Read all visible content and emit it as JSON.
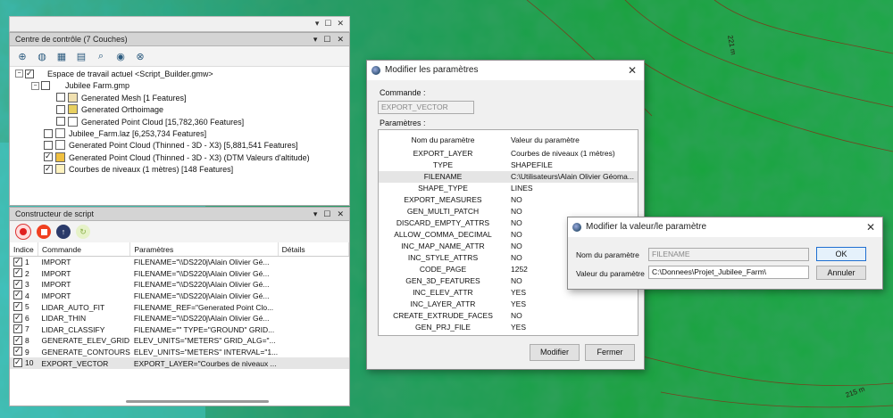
{
  "map": {
    "label_top": "221 m",
    "label_bottom": "215 m"
  },
  "control_center": {
    "title": "Centre de contrôle (7 Couches)",
    "tree": [
      {
        "label": "Espace de travail actuel <Script_Builder.gmw>",
        "checked": true
      },
      {
        "label": "Jubilee Farm.gmp",
        "checked": false
      },
      {
        "label": "Generated Mesh [1 Features]",
        "checked": false
      },
      {
        "label": "Generated Orthoimage",
        "checked": false
      },
      {
        "label": "Generated Point Cloud [15,782,360 Features]",
        "checked": false
      },
      {
        "label": "Jubilee_Farm.laz [6,253,734 Features]",
        "checked": false
      },
      {
        "label": "Generated Point Cloud (Thinned - 3D - X3) [5,881,541 Features]",
        "checked": false
      },
      {
        "label": "Generated Point Cloud (Thinned - 3D - X3) (DTM Valeurs d'altitude)",
        "checked": true
      },
      {
        "label": "Courbes de niveaux (1 mètres) [148 Features]",
        "checked": true
      }
    ]
  },
  "script_builder": {
    "title": "Constructeur de script",
    "columns": [
      "Indice",
      "Commande",
      "Paramètres",
      "Détails"
    ],
    "rows": [
      {
        "index": "1",
        "command": "IMPORT",
        "params": "FILENAME=\"\\\\DS220j\\Alain Olivier Gé..."
      },
      {
        "index": "2",
        "command": "IMPORT",
        "params": "FILENAME=\"\\\\DS220j\\Alain Olivier Gé..."
      },
      {
        "index": "3",
        "command": "IMPORT",
        "params": "FILENAME=\"\\\\DS220j\\Alain Olivier Gé..."
      },
      {
        "index": "4",
        "command": "IMPORT",
        "params": "FILENAME=\"\\\\DS220j\\Alain Olivier Gé..."
      },
      {
        "index": "5",
        "command": "LIDAR_AUTO_FIT",
        "params": "FILENAME_REF=\"Generated Point Clo..."
      },
      {
        "index": "6",
        "command": "LIDAR_THIN",
        "params": "FILENAME=\"\\\\DS220j\\Alain Olivier Gé..."
      },
      {
        "index": "7",
        "command": "LIDAR_CLASSIFY",
        "params": "FILENAME=\"\" TYPE=\"GROUND\" GRID..."
      },
      {
        "index": "8",
        "command": "GENERATE_ELEV_GRID",
        "params": "ELEV_UNITS=\"METERS\" GRID_ALG=\"..."
      },
      {
        "index": "9",
        "command": "GENERATE_CONTOURS",
        "params": "ELEV_UNITS=\"METERS\" INTERVAL=\"1..."
      },
      {
        "index": "10",
        "command": "EXPORT_VECTOR",
        "params": "EXPORT_LAYER=\"Courbes de niveaux ..."
      }
    ]
  },
  "modify_params": {
    "title": "Modifier les paramètres",
    "command_label": "Commande :",
    "command_value": "EXPORT_VECTOR",
    "params_label": "Paramètres :",
    "col_name": "Nom du paramètre",
    "col_value": "Valeur du paramètre",
    "rows": [
      {
        "name": "EXPORT_LAYER",
        "value": "Courbes de niveaux (1 mètres)"
      },
      {
        "name": "TYPE",
        "value": "SHAPEFILE"
      },
      {
        "name": "FILENAME",
        "value": "C:\\Utilisateurs\\Alain Olivier Géoma..."
      },
      {
        "name": "SHAPE_TYPE",
        "value": "LINES"
      },
      {
        "name": "EXPORT_MEASURES",
        "value": "NO"
      },
      {
        "name": "GEN_MULTI_PATCH",
        "value": "NO"
      },
      {
        "name": "DISCARD_EMPTY_ATTRS",
        "value": "NO"
      },
      {
        "name": "ALLOW_COMMA_DECIMAL",
        "value": "NO"
      },
      {
        "name": "INC_MAP_NAME_ATTR",
        "value": "NO"
      },
      {
        "name": "INC_STYLE_ATTRS",
        "value": "NO"
      },
      {
        "name": "CODE_PAGE",
        "value": "1252"
      },
      {
        "name": "GEN_3D_FEATURES",
        "value": "NO"
      },
      {
        "name": "INC_ELEV_ATTR",
        "value": "YES"
      },
      {
        "name": "INC_LAYER_ATTR",
        "value": "YES"
      },
      {
        "name": "CREATE_EXTRUDE_FACES",
        "value": "NO"
      },
      {
        "name": "GEN_PRJ_FILE",
        "value": "YES"
      }
    ],
    "modify_button": "Modifier",
    "close_button": "Fermer"
  },
  "modify_value": {
    "title": "Modifier la valeur/le paramètre",
    "name_label": "Nom du paramètre",
    "name_value": "FILENAME",
    "value_label": "Valeur du paramètre",
    "value_value": "C:\\Donnees\\Projet_Jubilee_Farm\\",
    "ok_button": "OK",
    "cancel_button": "Annuler"
  },
  "colors": {
    "map_green": "#1a8a4c",
    "map_cyan": "#3fc8c8",
    "dialog_bg": "#f0f0f0",
    "ok_border": "#1f6fd0"
  }
}
